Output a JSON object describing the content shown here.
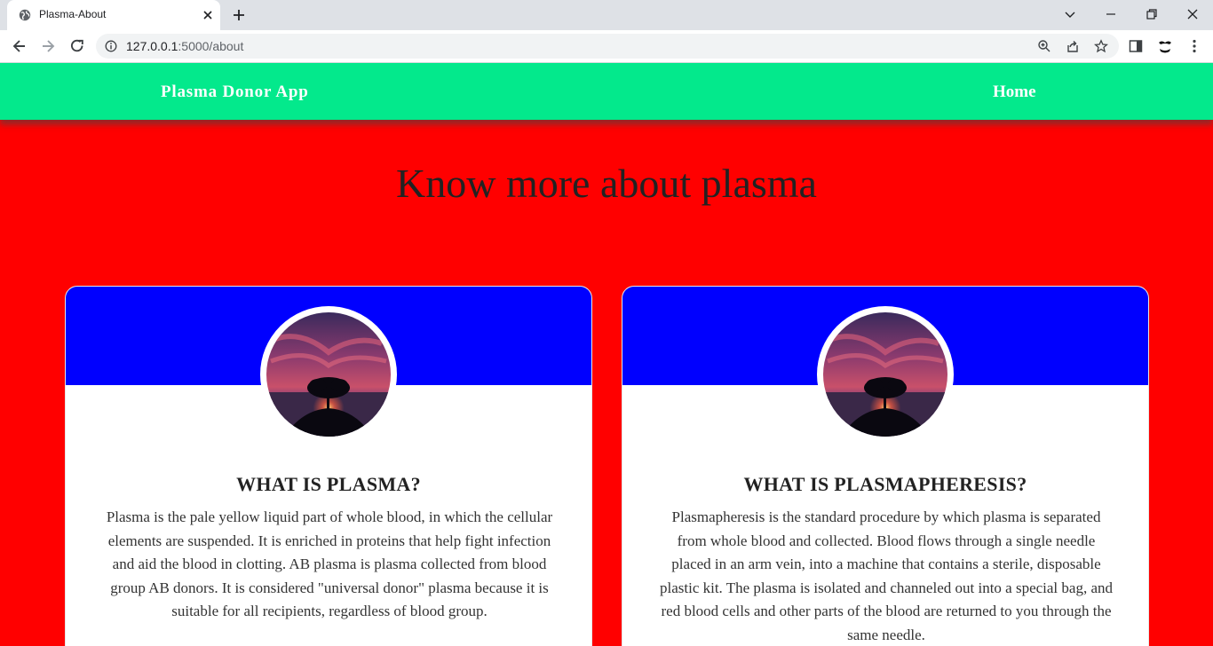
{
  "browser": {
    "tab_title": "Plasma-About",
    "url_host": "127.0.0.1",
    "url_path": ":5000/about"
  },
  "navbar": {
    "brand": "Plasma Donor App",
    "home_link": "Home"
  },
  "page": {
    "title": "Know more about plasma"
  },
  "cards": [
    {
      "heading": "WHAT IS PLASMA?",
      "text": "Plasma is the pale yellow liquid part of whole blood, in which the cellular elements are suspended. It is enriched in proteins that help fight infection and aid the blood in clotting. AB plasma is plasma collected from blood group AB donors. It is considered \"universal donor\" plasma because it is suitable for all recipients, regardless of blood group."
    },
    {
      "heading": "WHAT IS PLASMAPHERESIS?",
      "text": "Plasmapheresis is the standard procedure by which plasma is separated from whole blood and collected. Blood flows through a single needle placed in an arm vein, into a machine that contains a sterile, disposable plastic kit. The plasma is isolated and channeled out into a special bag, and red blood cells and other parts of the blood are returned to you through the same needle."
    }
  ],
  "colors": {
    "page_background": "#ff0000",
    "navbar_background": "#03e98c",
    "card_band": "#0000ff",
    "card_background": "#ffffff"
  },
  "icons": [
    "globe-icon",
    "close-icon",
    "plus-icon",
    "chevron-down-icon",
    "minimize-icon",
    "restore-icon",
    "back-arrow-icon",
    "forward-arrow-icon",
    "reload-icon",
    "info-icon",
    "zoom-icon",
    "share-icon",
    "star-icon",
    "side-panel-icon",
    "profile-icon",
    "kebab-menu-icon"
  ]
}
